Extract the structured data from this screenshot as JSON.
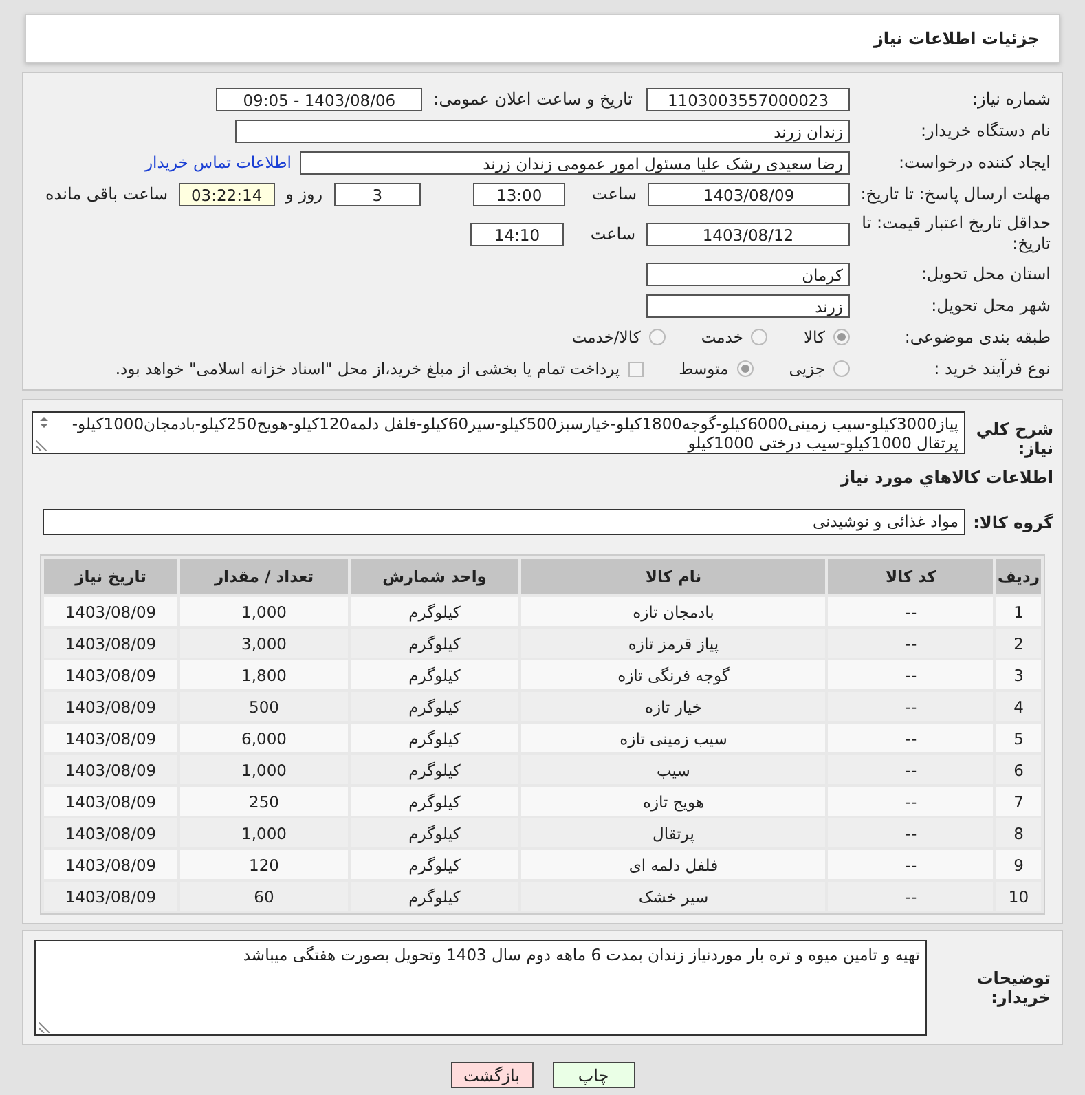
{
  "page_title": "جزئیات اطلاعات نیاز",
  "need_number": {
    "label": "شماره نیاز:",
    "value": "1103003557000023"
  },
  "announce": {
    "label": "تاریخ و ساعت اعلان عمومی:",
    "value": "1403/08/06 - 09:05"
  },
  "buyer_org": {
    "label": "نام دستگاه خریدار:",
    "value": "زندان زرند"
  },
  "requester": {
    "label": "ایجاد کننده درخواست:",
    "value": "رضا سعیدی رشک علیا مسئول امور عمومی زندان زرند",
    "link": "اطلاعات تماس خریدار"
  },
  "deadline": {
    "label": "مهلت ارسال پاسخ: تا تاریخ:",
    "date": "1403/08/09",
    "time_label": "ساعت",
    "time": "13:00",
    "days": "3",
    "days_label": "روز و",
    "remaining": "03:22:14",
    "remaining_label": "ساعت باقی مانده"
  },
  "validity": {
    "label": "حداقل تاریخ اعتبار قیمت: تا تاریخ:",
    "date": "1403/08/12",
    "time_label": "ساعت",
    "time": "14:10"
  },
  "province": {
    "label": "استان محل تحویل:",
    "value": "کرمان"
  },
  "city": {
    "label": "شهر محل تحویل:",
    "value": "زرند"
  },
  "category": {
    "label": "طبقه بندی موضوعی:",
    "options": [
      {
        "label": "کالا",
        "selected": true
      },
      {
        "label": "خدمت",
        "selected": false
      },
      {
        "label": "کالا/خدمت",
        "selected": false
      }
    ]
  },
  "purchase_type": {
    "label": "نوع فرآیند خرید :",
    "options": [
      {
        "label": "جزیی",
        "selected": false
      },
      {
        "label": "متوسط",
        "selected": true
      }
    ],
    "payment": {
      "checked": false,
      "text": "پرداخت تمام یا بخشی از مبلغ خرید،از محل \"اسناد خزانه اسلامی\" خواهد بود."
    }
  },
  "summary": {
    "label": "شرح کلي نياز:",
    "value": "پیاز3000کیلو-سیب زمینی6000کیلو-گوجه1800کیلو-خیارسبز500کیلو-سیر60کیلو-فلفل دلمه120کیلو-هویج250کیلو-بادمجان1000کیلو-پرتقال 1000کیلو-سیب درختی 1000کیلو"
  },
  "goods_heading": "اطلاعات کالاهاي مورد نياز",
  "goods_group": {
    "label": "گروه کالا:",
    "value": "مواد غذائی و نوشیدنی"
  },
  "table": {
    "columns": [
      "ردیف",
      "کد کالا",
      "نام کالا",
      "واحد شمارش",
      "تعداد / مقدار",
      "تاریخ نیاز"
    ],
    "rows": [
      [
        "1",
        "--",
        "بادمجان تازه",
        "کیلوگرم",
        "1,000",
        "1403/08/09"
      ],
      [
        "2",
        "--",
        "پیاز قرمز تازه",
        "کیلوگرم",
        "3,000",
        "1403/08/09"
      ],
      [
        "3",
        "--",
        "گوجه فرنگی تازه",
        "کیلوگرم",
        "1,800",
        "1403/08/09"
      ],
      [
        "4",
        "--",
        "خیار تازه",
        "کیلوگرم",
        "500",
        "1403/08/09"
      ],
      [
        "5",
        "--",
        "سیب زمینی تازه",
        "کیلوگرم",
        "6,000",
        "1403/08/09"
      ],
      [
        "6",
        "--",
        "سیب",
        "کیلوگرم",
        "1,000",
        "1403/08/09"
      ],
      [
        "7",
        "--",
        "هویج تازه",
        "کیلوگرم",
        "250",
        "1403/08/09"
      ],
      [
        "8",
        "--",
        "پرتقال",
        "کیلوگرم",
        "1,000",
        "1403/08/09"
      ],
      [
        "9",
        "--",
        "فلفل دلمه ای",
        "کیلوگرم",
        "120",
        "1403/08/09"
      ],
      [
        "10",
        "--",
        "سیر خشک",
        "کیلوگرم",
        "60",
        "1403/08/09"
      ]
    ]
  },
  "buyer_notes": {
    "label": "توضیحات خریدار:",
    "value": "تهیه و تامین میوه و تره بار موردنیاز زندان بمدت 6 ماهه دوم سال 1403 وتحویل بصورت هفتگی میباشد"
  },
  "buttons": [
    {
      "label": "چاپ",
      "kind": "print"
    },
    {
      "label": "بازگشت",
      "kind": "back"
    }
  ]
}
